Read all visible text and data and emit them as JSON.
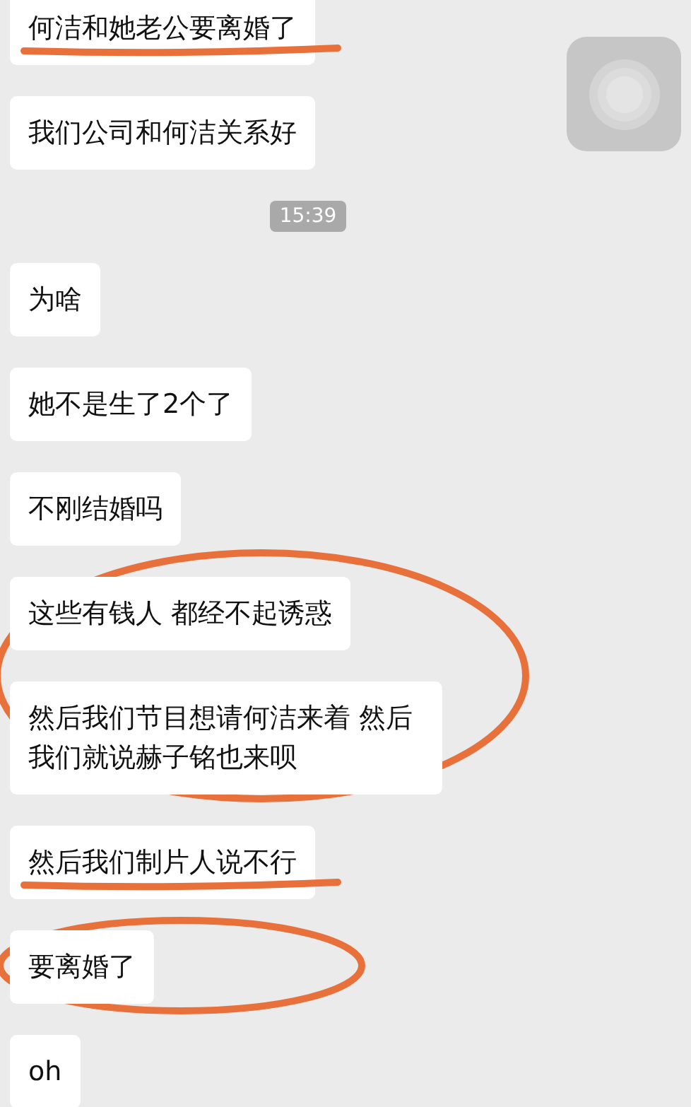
{
  "items": [
    {
      "kind": "message",
      "text": "何洁和她老公要离婚了",
      "underlined": true,
      "circled": false
    },
    {
      "kind": "message",
      "text": "我们公司和何洁关系好",
      "underlined": false,
      "circled": false
    },
    {
      "kind": "timestamp",
      "text": "15:39"
    },
    {
      "kind": "message",
      "text": "为啥",
      "underlined": false,
      "circled": false
    },
    {
      "kind": "message",
      "text": "她不是生了2个了",
      "underlined": false,
      "circled": false
    },
    {
      "kind": "message",
      "text": "不刚结婚吗",
      "underlined": false,
      "circled": false
    },
    {
      "kind": "circled_group",
      "messages": [
        {
          "text": "这些有钱人 都经不起诱惑"
        },
        {
          "text": "然后我们节目想请何洁来着 然后我们就说赫子铭也来呗"
        }
      ]
    },
    {
      "kind": "message",
      "text": "然后我们制片人说不行",
      "underlined": true,
      "circled": false
    },
    {
      "kind": "message",
      "text": "要离婚了",
      "underlined": false,
      "circled": true
    },
    {
      "kind": "message",
      "text": "oh",
      "underlined": false,
      "circled": false
    }
  ]
}
